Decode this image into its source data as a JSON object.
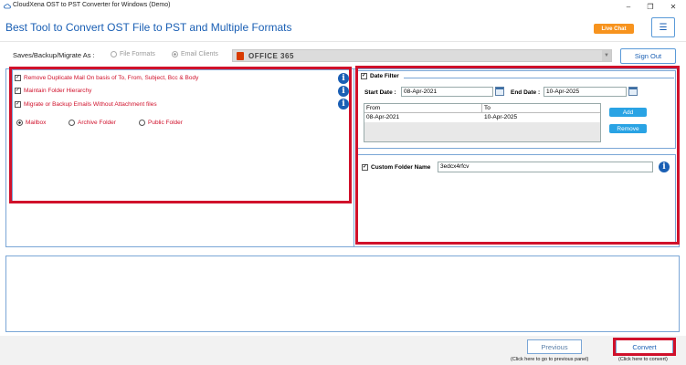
{
  "window": {
    "title": "CloudXena OST to PST Converter for Windows (Demo)",
    "minimize_icon": "minimize-icon",
    "restore_icon": "restore-icon",
    "close_icon": "close-icon"
  },
  "header": {
    "heading": "Best Tool to Convert OST File to PST and Multiple Formats",
    "live_chat": "Live Chat",
    "menu_icon": "hamburger-icon"
  },
  "save_row": {
    "label": "Saves/Backup/Migrate As :",
    "options": [
      {
        "label": "File Formats",
        "selected": false
      },
      {
        "label": "Email Clients",
        "selected": true
      }
    ],
    "selected_target": "OFFICE 365",
    "sign_out": "Sign Out"
  },
  "options": {
    "items": [
      {
        "label": "Remove Duplicate Mail On basis of To, From, Subject, Bcc & Body",
        "checked": true
      },
      {
        "label": "Maintain Folder Hierarchy",
        "checked": true
      },
      {
        "label": "Migrate or Backup Emails Without Attachment files",
        "checked": true
      }
    ],
    "mailbox_types": [
      {
        "label": "Mailbox",
        "selected": true
      },
      {
        "label": "Archive Folder",
        "selected": false
      },
      {
        "label": "Public Folder",
        "selected": false
      }
    ]
  },
  "date_filter": {
    "title": "Date Filter",
    "checked": true,
    "start_label": "Start Date :",
    "start_value": "08-Apr-2021",
    "end_label": "End Date :",
    "end_value": "10-Apr-2025",
    "table_headers": {
      "from": "From",
      "to": "To"
    },
    "rows": [
      {
        "from": "08-Apr-2021",
        "to": "10-Apr-2025"
      }
    ],
    "add_label": "Add",
    "remove_label": "Remove"
  },
  "custom_folder": {
    "label": "Custom Folder Name",
    "checked": true,
    "value": "3edcx4rfcv"
  },
  "footer": {
    "previous": "Previous",
    "previous_hint": "(Click here to go to previous panel)",
    "convert": "Convert",
    "convert_hint": "(Click here to convert)"
  },
  "colors": {
    "accent": "#1a5fb4",
    "highlight_red": "#d0112b",
    "live_chat": "#f7931e",
    "button_blue": "#29a3e4"
  }
}
